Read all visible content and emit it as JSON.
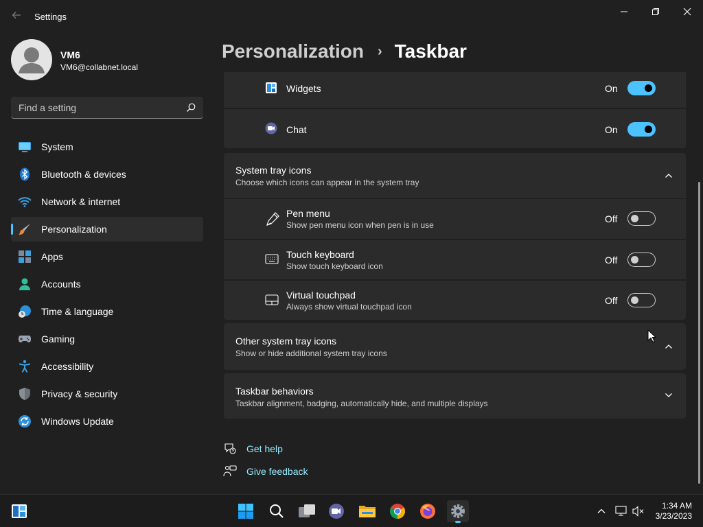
{
  "window": {
    "title": "Settings"
  },
  "profile": {
    "name": "VM6",
    "email": "VM6@collabnet.local"
  },
  "search": {
    "placeholder": "Find a setting"
  },
  "sidebar": {
    "items": [
      {
        "label": "System",
        "icon": "monitor-icon"
      },
      {
        "label": "Bluetooth & devices",
        "icon": "bluetooth-icon"
      },
      {
        "label": "Network & internet",
        "icon": "wifi-icon"
      },
      {
        "label": "Personalization",
        "icon": "brush-icon",
        "active": true
      },
      {
        "label": "Apps",
        "icon": "apps-icon"
      },
      {
        "label": "Accounts",
        "icon": "person-icon"
      },
      {
        "label": "Time & language",
        "icon": "globe-clock-icon"
      },
      {
        "label": "Gaming",
        "icon": "gamepad-icon"
      },
      {
        "label": "Accessibility",
        "icon": "accessibility-icon"
      },
      {
        "label": "Privacy & security",
        "icon": "shield-icon"
      },
      {
        "label": "Windows Update",
        "icon": "update-icon"
      }
    ]
  },
  "header": {
    "parent": "Personalization",
    "separator": "›",
    "current": "Taskbar"
  },
  "taskbar_items": {
    "widgets": {
      "label": "Widgets",
      "state": "On"
    },
    "chat": {
      "label": "Chat",
      "state": "On"
    }
  },
  "system_tray": {
    "title": "System tray icons",
    "subtitle": "Choose which icons can appear in the system tray",
    "items": [
      {
        "label": "Pen menu",
        "sub": "Show pen menu icon when pen is in use",
        "state": "Off"
      },
      {
        "label": "Touch keyboard",
        "sub": "Show touch keyboard icon",
        "state": "Off"
      },
      {
        "label": "Virtual touchpad",
        "sub": "Always show virtual touchpad icon",
        "state": "Off"
      }
    ]
  },
  "other_tray": {
    "title": "Other system tray icons",
    "subtitle": "Show or hide additional system tray icons"
  },
  "behaviors": {
    "title": "Taskbar behaviors",
    "subtitle": "Taskbar alignment, badging, automatically hide, and multiple displays"
  },
  "help": {
    "get_help": "Get help",
    "feedback": "Give feedback"
  },
  "clock": {
    "time": "1:34 AM",
    "date": "3/23/2023"
  },
  "colors": {
    "accent": "#4cc2ff",
    "background": "#202020",
    "card": "#2b2b2b",
    "link": "#99ebff"
  }
}
